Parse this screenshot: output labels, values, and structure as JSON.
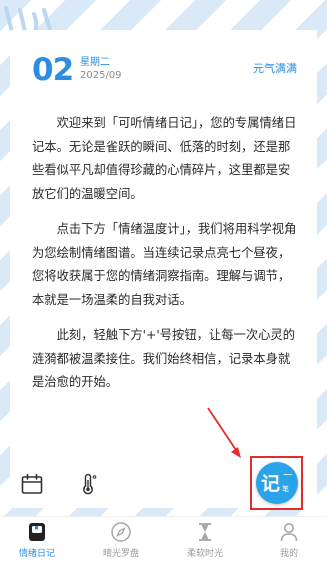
{
  "header": {
    "day": "02",
    "weekday": "星期二",
    "year_month": "2025/09",
    "mood_tag": "元气满满"
  },
  "content": {
    "paragraphs": [
      "欢迎来到「可听情绪日记」，您的专属情绪日记本。无论是雀跃的瞬间、低落的时刻，还是那些看似平凡却值得珍藏的心情碎片，这里都是安放它们的温暖空间。",
      "点击下方「情绪温度计」，我们将用科学视角为您绘制情绪图谱。当连续记录点亮七个昼夜，您将收获属于您的情绪洞察指南。理解与调节，本就是一场温柔的自我对话。",
      "此刻，轻触下方'+'号按钮，让每一次心灵的涟漪都被温柔接住。我们始终相信，记录本身就是治愈的开始。"
    ]
  },
  "tools": {
    "calendar_icon": "calendar-icon",
    "thermometer_icon": "thermometer-icon"
  },
  "fab": {
    "main_label": "记",
    "dash_label": "一",
    "sub_label": "笔"
  },
  "tabbar": {
    "tabs": [
      {
        "label": "情绪日记",
        "icon": "diary-icon",
        "active": true
      },
      {
        "label": "晴光罗盘",
        "icon": "compass-icon",
        "active": false
      },
      {
        "label": "柔软时光",
        "icon": "hourglass-icon",
        "active": false
      },
      {
        "label": "我的",
        "icon": "person-icon",
        "active": false
      }
    ]
  },
  "colors": {
    "accent": "#2b8de3",
    "fab": "#2aa3e9",
    "highlight": "#e32c2c",
    "stripe": "#d9e9f8"
  }
}
